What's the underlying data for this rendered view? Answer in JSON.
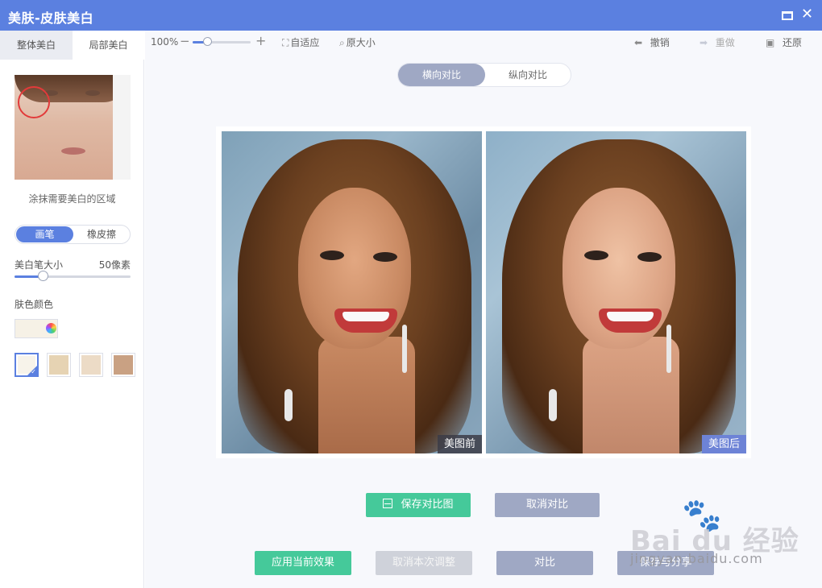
{
  "window": {
    "title": "美肤-皮肤美白",
    "maximize_icon": "maximize-icon",
    "close_icon": "close-icon",
    "close_glyph": "✕"
  },
  "sidebar": {
    "tabs": [
      {
        "label": "整体美白",
        "active": false
      },
      {
        "label": "局部美白",
        "active": true
      }
    ],
    "hint": "涂抹需要美白的区域",
    "tool_toggle": {
      "options": [
        "画笔",
        "橡皮擦"
      ],
      "selected": "画笔"
    },
    "brush_size": {
      "label": "美白笔大小",
      "value": "50像素",
      "level": 0.24
    },
    "skin_color": {
      "label": "肤色颜色",
      "picker_color": "#f6f1e6",
      "swatches": [
        {
          "color": "#f7f3ea",
          "selected": true
        },
        {
          "color": "#e6d3b3",
          "selected": false
        },
        {
          "color": "#ecdbc6",
          "selected": false
        },
        {
          "color": "#c9a183",
          "selected": false
        }
      ]
    }
  },
  "toolbar": {
    "zoom": {
      "percent": "100%",
      "level": 0.25
    },
    "fit_label": "自适应",
    "original_size_label": "原大小",
    "undo_label": "撤销",
    "redo_label": "重做",
    "restore_label": "还原",
    "icons": {
      "fit": "fit-icon",
      "zoom": "magnifier-icon",
      "undo": "undo-arrow-icon",
      "redo": "redo-arrow-icon",
      "restore": "image-icon"
    }
  },
  "compare": {
    "modes": [
      "横向对比",
      "纵向对比"
    ],
    "selected": "横向对比",
    "before_label": "美图前",
    "after_label": "美图后"
  },
  "buttons": {
    "save_compare": "保存对比图",
    "cancel_compare": "取消对比",
    "apply": "应用当前效果",
    "cancel_adjust": "取消本次调整",
    "compare": "对比",
    "save_share": "保存与分享"
  },
  "watermark": {
    "text": "Bai du 经验",
    "sub": "jingyan.baidu.com"
  },
  "colors": {
    "accent": "#5b80e0",
    "green": "#45c99a",
    "gray_button": "#9fa8c4"
  }
}
